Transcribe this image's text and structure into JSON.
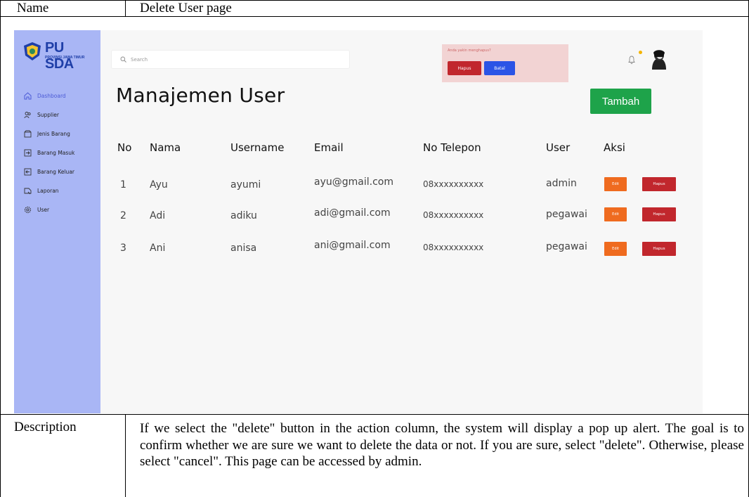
{
  "doc": {
    "name_label": "Name",
    "name_value": "Delete User page",
    "description_label": "Description",
    "description_text": "If we select the \"delete\" button in the action column, the system will display a pop up alert. The goal is to confirm whether we are sure we want to delete the data or not. If you are sure, select \"delete\". Otherwise, please select \"cancel\". This page can be accessed by admin."
  },
  "app": {
    "logo_text": "PU SDA",
    "logo_sub": "PROVINSI JAWA TIMUR",
    "search_placeholder": "Search",
    "page_title": "Manajemen User",
    "add_button": "Tambah",
    "alert": {
      "message": "Anda yakin menghapus?",
      "confirm_label": "Hapus",
      "cancel_label": "Batal"
    },
    "sidebar": {
      "items": [
        {
          "label": "Dashboard",
          "icon": "home-icon"
        },
        {
          "label": "Supplier",
          "icon": "users-icon"
        },
        {
          "label": "Jenis Barang",
          "icon": "box-icon"
        },
        {
          "label": "Barang Masuk",
          "icon": "login-icon"
        },
        {
          "label": "Barang Keluar",
          "icon": "logout-icon"
        },
        {
          "label": "Laporan",
          "icon": "report-icon"
        },
        {
          "label": "User",
          "icon": "gear-icon"
        }
      ]
    },
    "table": {
      "headers": [
        "No",
        "Nama",
        "Username",
        "Email",
        "No Telepon",
        "User",
        "Aksi"
      ],
      "rows": [
        {
          "no": "1",
          "nama": "Ayu",
          "username": "ayumi",
          "email": "ayu@gmail.com",
          "telepon": "08xxxxxxxxxx",
          "user": "admin",
          "edit": "Edit",
          "hapus": "Hapus"
        },
        {
          "no": "2",
          "nama": "Adi",
          "username": "adiku",
          "email": "adi@gmail.com",
          "telepon": "08xxxxxxxxxx",
          "user": "pegawai",
          "edit": "Edit",
          "hapus": "Hapus"
        },
        {
          "no": "3",
          "nama": "Ani",
          "username": "anisa",
          "email": "ani@gmail.com",
          "telepon": "08xxxxxxxxxx",
          "user": "pegawai",
          "edit": "Edit",
          "hapus": "Hapus"
        }
      ]
    },
    "colors": {
      "sidebar": "#a9b6f5",
      "active_nav": "#4b5ad6",
      "add_button": "#1ea34a",
      "edit_button": "#ef6b1f",
      "delete_button": "#c1272d",
      "cancel_button": "#2b54e6",
      "alert_bg": "#f2d3d3"
    }
  }
}
